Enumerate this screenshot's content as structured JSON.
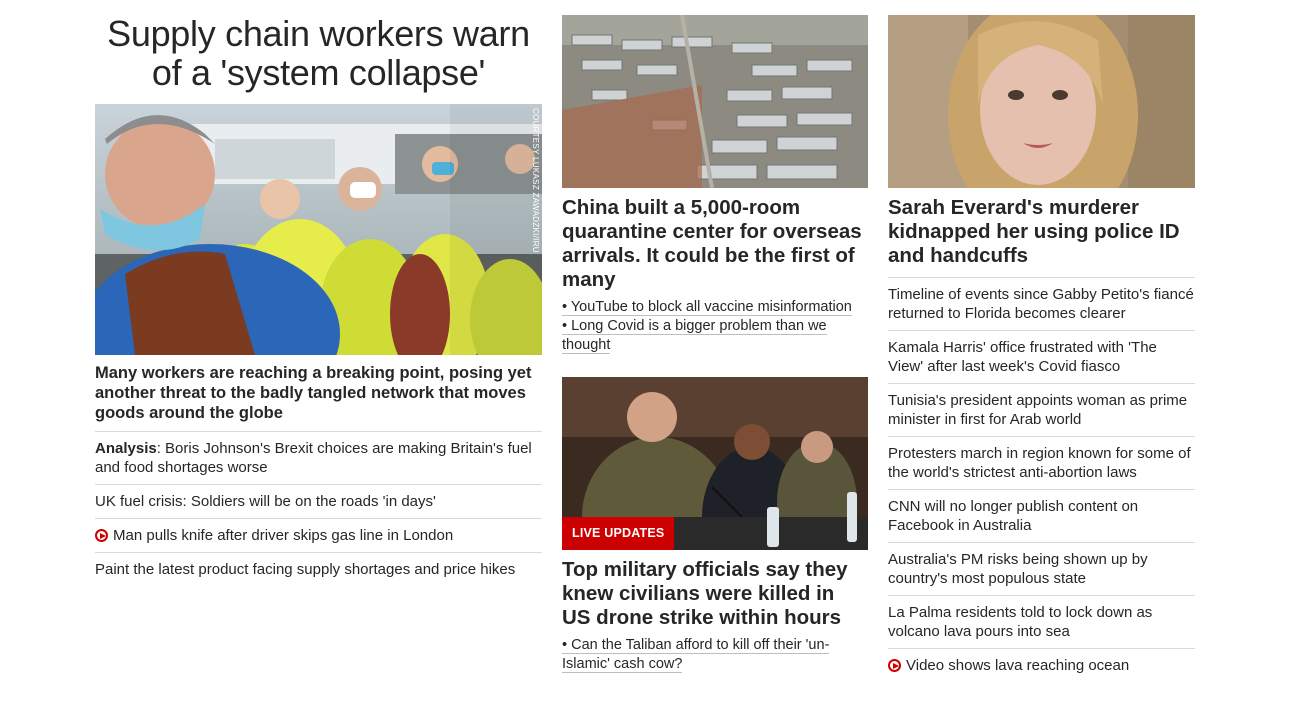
{
  "lead": {
    "headline": "Supply chain workers warn of a 'system collapse'",
    "photo_credit": "COURTESY LUKASZ ZAWADZKI/IRU",
    "subhead": "Many workers are reaching a breaking point, posing yet another threat to the badly tangled network that moves goods around the globe",
    "links": [
      {
        "prefix": "Analysis",
        "text": ": Boris Johnson's Brexit choices are making Britain's fuel and food shortages worse"
      },
      {
        "text": "UK fuel crisis: Soldiers will be on the roads 'in days'"
      },
      {
        "text": "Man pulls knife after driver skips gas line in London",
        "icon": "play-circle-icon"
      },
      {
        "text": "Paint the latest product facing supply shortages and price hikes"
      }
    ]
  },
  "middle": {
    "story1": {
      "title": "China built a 5,000-room quarantine center for overseas arrivals. It could be the first of many",
      "bullets": [
        "• YouTube to block all vaccine misinformation",
        "• Long Covid is a bigger problem than we thought"
      ]
    },
    "story2": {
      "badge": "LIVE UPDATES",
      "title": "Top military officials say they knew civilians were killed in US drone strike within hours",
      "bullets": [
        "• Can the Taliban afford to kill off their 'un-Islamic' cash cow?"
      ]
    }
  },
  "right": {
    "story": {
      "title": "Sarah Everard's murderer kidnapped her using police ID and handcuffs"
    },
    "links": [
      {
        "text": "Timeline of events since Gabby Petito's fiancé returned to Florida becomes clearer"
      },
      {
        "text": "Kamala Harris' office frustrated with 'The View' after last week's Covid fiasco"
      },
      {
        "text": "Tunisia's president appoints woman as prime minister in first for Arab world"
      },
      {
        "text": "Protesters march in region known for some of the world's strictest anti-abortion laws"
      },
      {
        "text": "CNN will no longer publish content on Facebook in Australia"
      },
      {
        "text": "Australia's PM risks being shown up by country's most populous state"
      },
      {
        "text": "La Palma residents told to lock down as volcano lava pours into sea"
      },
      {
        "text": "Video shows lava reaching ocean",
        "icon": "play-circle-icon"
      }
    ]
  },
  "colors": {
    "accent": "#cc0000",
    "text": "#262626",
    "divider": "#d9d9d9"
  }
}
